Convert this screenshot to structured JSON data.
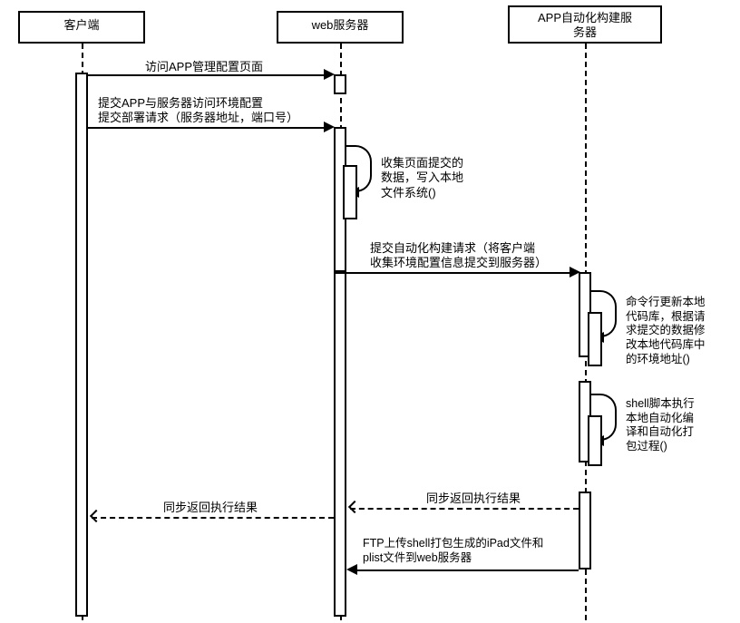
{
  "participants": {
    "client": "客户端",
    "web": "web服务器",
    "app": "APP自动化构建服\n务器"
  },
  "messages": {
    "m1": "访问APP管理配置页面",
    "m2a": "提交APP与服务器访问环境配置",
    "m2b": "提交部署请求（服务器地址，端口号）",
    "m3": "收集页面提交的\n数据，写入本地\n文件系统()",
    "m4": "提交自动化构建请求（将客户端\n收集环境配置信息提交到服务器）",
    "m5": "命令行更新本地\n代码库，根据请\n求提交的数据修\n改本地代码库中\n的环境地址()",
    "m6": "shell脚本执行\n本地自动化编\n译和自动化打\n包过程()",
    "m7a": "同步返回执行结果",
    "m7b": "同步返回执行结果",
    "m8": "FTP上传shell打包生成的iPad文件和\nplist文件到web服务器"
  },
  "chart_data": {
    "type": "sequence",
    "participants": [
      "客户端",
      "web服务器",
      "APP自动化构建服务器"
    ],
    "messages": [
      {
        "from": "客户端",
        "to": "web服务器",
        "text": "访问APP管理配置页面",
        "style": "sync"
      },
      {
        "from": "客户端",
        "to": "web服务器",
        "text": "提交APP与服务器访问环境配置 / 提交部署请求（服务器地址，端口号）",
        "style": "sync"
      },
      {
        "from": "web服务器",
        "to": "web服务器",
        "text": "收集页面提交的数据，写入本地文件系统()",
        "style": "self"
      },
      {
        "from": "web服务器",
        "to": "APP自动化构建服务器",
        "text": "提交自动化构建请求（将客户端收集环境配置信息提交到服务器）",
        "style": "sync"
      },
      {
        "from": "APP自动化构建服务器",
        "to": "APP自动化构建服务器",
        "text": "命令行更新本地代码库，根据请求提交的数据修改本地代码库中的环境地址()",
        "style": "self"
      },
      {
        "from": "APP自动化构建服务器",
        "to": "APP自动化构建服务器",
        "text": "shell脚本执行本地自动化编译和自动化打包过程()",
        "style": "self"
      },
      {
        "from": "APP自动化构建服务器",
        "to": "web服务器",
        "text": "同步返回执行结果",
        "style": "return"
      },
      {
        "from": "web服务器",
        "to": "客户端",
        "text": "同步返回执行结果",
        "style": "return"
      },
      {
        "from": "APP自动化构建服务器",
        "to": "web服务器",
        "text": "FTP上传shell打包生成的iPad文件和plist文件到web服务器",
        "style": "sync"
      }
    ]
  }
}
